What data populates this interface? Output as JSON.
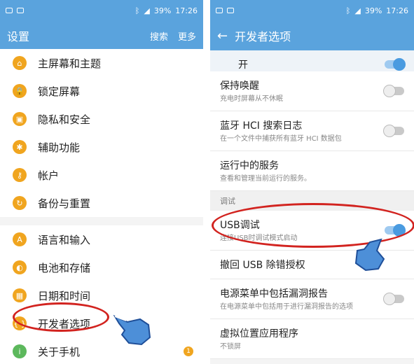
{
  "left": {
    "status": {
      "battery": "39%",
      "time": "17:26"
    },
    "appbar": {
      "title": "设置",
      "search": "搜索",
      "more": "更多"
    },
    "items_top": [
      {
        "label": "主屏幕和主题",
        "icon": "home-icon",
        "glyph": "⌂"
      },
      {
        "label": "锁定屏幕",
        "icon": "lock-icon",
        "glyph": "🔒"
      },
      {
        "label": "隐私和安全",
        "icon": "shield-icon",
        "glyph": "▣"
      },
      {
        "label": "辅助功能",
        "icon": "accessibility-icon",
        "glyph": "✱"
      },
      {
        "label": "帐户",
        "icon": "key-icon",
        "glyph": "⚷"
      },
      {
        "label": "备份与重置",
        "icon": "backup-icon",
        "glyph": "↻"
      }
    ],
    "items_bottom": [
      {
        "label": "语言和输入",
        "icon": "language-icon",
        "glyph": "A"
      },
      {
        "label": "电池和存储",
        "icon": "battery-icon",
        "glyph": "◐"
      },
      {
        "label": "日期和时间",
        "icon": "calendar-icon",
        "glyph": "▦"
      },
      {
        "label": "开发者选项",
        "icon": "developer-icon",
        "glyph": "{ }"
      },
      {
        "label": "关于手机",
        "icon": "info-icon",
        "glyph": "i"
      }
    ],
    "about_badge": "1"
  },
  "right": {
    "status": {
      "battery": "39%",
      "time": "17:26"
    },
    "appbar": {
      "title": "开发者选项"
    },
    "master_toggle": {
      "label": "开",
      "on": true
    },
    "items_a": [
      {
        "title": "保持唤醒",
        "sub": "充电时屏幕从不休眠",
        "toggle": "off"
      },
      {
        "title": "蓝牙 HCI 搜索日志",
        "sub": "在一个文件中捕获所有蓝牙 HCI 数据包",
        "toggle": "off"
      },
      {
        "title": "运行中的服务",
        "sub": "查看和管理当前运行的服务。",
        "toggle": "none"
      }
    ],
    "section": "调试",
    "items_b": [
      {
        "title": "USB调试",
        "sub": "连接USB时调试模式启动",
        "toggle": "on"
      },
      {
        "title": "撤回 USB 除错授权",
        "sub": "",
        "toggle": "none"
      },
      {
        "title": "电源菜单中包括漏洞报告",
        "sub": "在电源菜单中包括用于进行漏洞报告的选项",
        "toggle": "off"
      },
      {
        "title": "虚拟位置应用程序",
        "sub": "不锁屏",
        "toggle": "none"
      }
    ]
  }
}
